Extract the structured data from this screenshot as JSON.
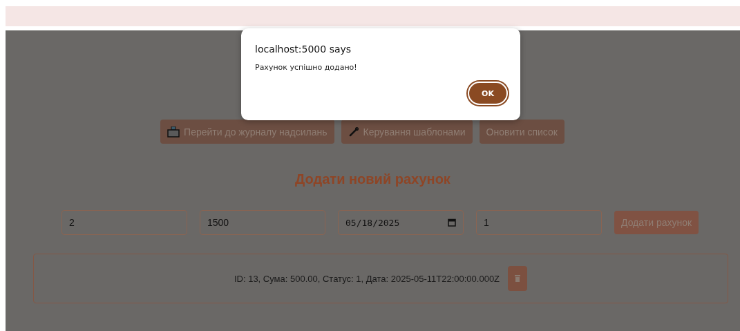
{
  "dialog": {
    "title": "localhost:5000 says",
    "message": "Рахунок успішно додано!",
    "ok_label": "OK"
  },
  "nav_buttons": [
    {
      "kind": "mailbox",
      "label": "Перейти до журналу надсилань"
    },
    {
      "kind": "wrench",
      "label": "Керування шаблонами"
    },
    {
      "kind": "none",
      "label": "Оновити список"
    }
  ],
  "heading": "Додати новий рахунок",
  "fields": [
    {
      "kind": "text",
      "value": "2"
    },
    {
      "kind": "text",
      "value": "1500"
    },
    {
      "kind": "date",
      "value": "05/18/2025"
    },
    {
      "kind": "text",
      "value": "1"
    }
  ],
  "add_button": "Додати рахунок",
  "invoices": [
    {
      "text": "ID: 13, Сума: 500.00, Статус: 1, Дата: 2025-05-11T22:00:00.000Z"
    }
  ]
}
